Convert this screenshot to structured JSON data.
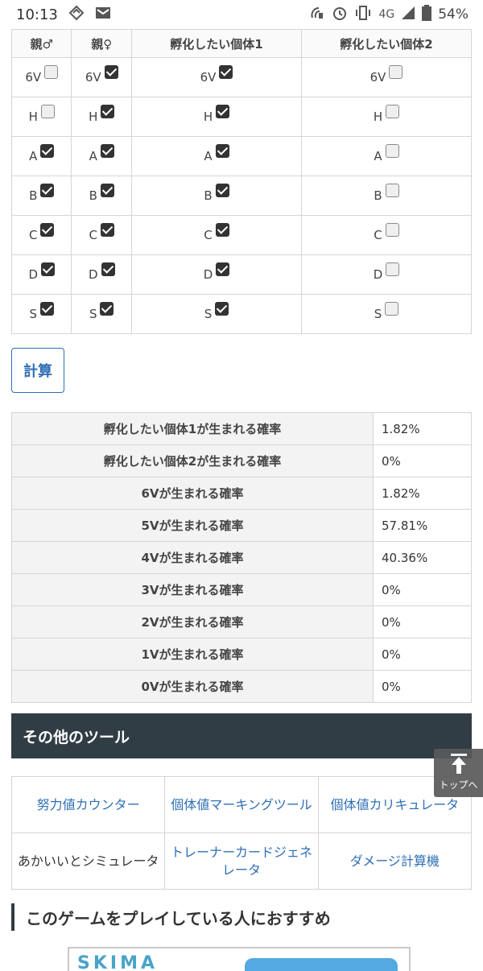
{
  "status_bar": {
    "time": "10:13",
    "network": "4G",
    "battery": "54%"
  },
  "parent_table": {
    "headers": [
      "親♂",
      "親♀",
      "孵化したい個体1",
      "孵化したい個体2"
    ],
    "rows": [
      {
        "label": "6V",
        "checks": [
          false,
          true,
          true,
          false
        ]
      },
      {
        "label": "H",
        "checks": [
          false,
          true,
          true,
          false
        ]
      },
      {
        "label": "A",
        "checks": [
          true,
          true,
          true,
          false
        ]
      },
      {
        "label": "B",
        "checks": [
          true,
          true,
          true,
          false
        ]
      },
      {
        "label": "C",
        "checks": [
          true,
          true,
          true,
          false
        ]
      },
      {
        "label": "D",
        "checks": [
          true,
          true,
          true,
          false
        ]
      },
      {
        "label": "S",
        "checks": [
          true,
          true,
          true,
          false
        ]
      }
    ]
  },
  "calc_button_label": "計算",
  "results": [
    {
      "label": "孵化したい個体1が生まれる確率",
      "value": "1.82%"
    },
    {
      "label": "孵化したい個体2が生まれる確率",
      "value": "0%"
    },
    {
      "label": "6Vが生まれる確率",
      "value": "1.82%"
    },
    {
      "label": "5Vが生まれる確率",
      "value": "57.81%"
    },
    {
      "label": "4Vが生まれる確率",
      "value": "40.36%"
    },
    {
      "label": "3Vが生まれる確率",
      "value": "0%"
    },
    {
      "label": "2Vが生まれる確率",
      "value": "0%"
    },
    {
      "label": "1Vが生まれる確率",
      "value": "0%"
    },
    {
      "label": "0Vが生まれる確率",
      "value": "0%"
    }
  ],
  "other_tools": {
    "title": "その他のツール",
    "items": [
      {
        "label": "努力値カウンター",
        "link": true
      },
      {
        "label": "個体値マーキングツール",
        "link": true
      },
      {
        "label": "個体値カリキュレータ",
        "link": true
      },
      {
        "label": "あかいいとシミュレータ",
        "link": false
      },
      {
        "label": "トレーナーカードジェネレータ",
        "link": true
      },
      {
        "label": "ダメージ計算機",
        "link": true
      }
    ]
  },
  "back_to_top_label": "トップへ",
  "recommend_heading": "このゲームをプレイしている人におすすめ",
  "colors": {
    "link_blue": "#2f6fb5",
    "header_dark": "#313d44",
    "border": "#d5d5d5"
  }
}
